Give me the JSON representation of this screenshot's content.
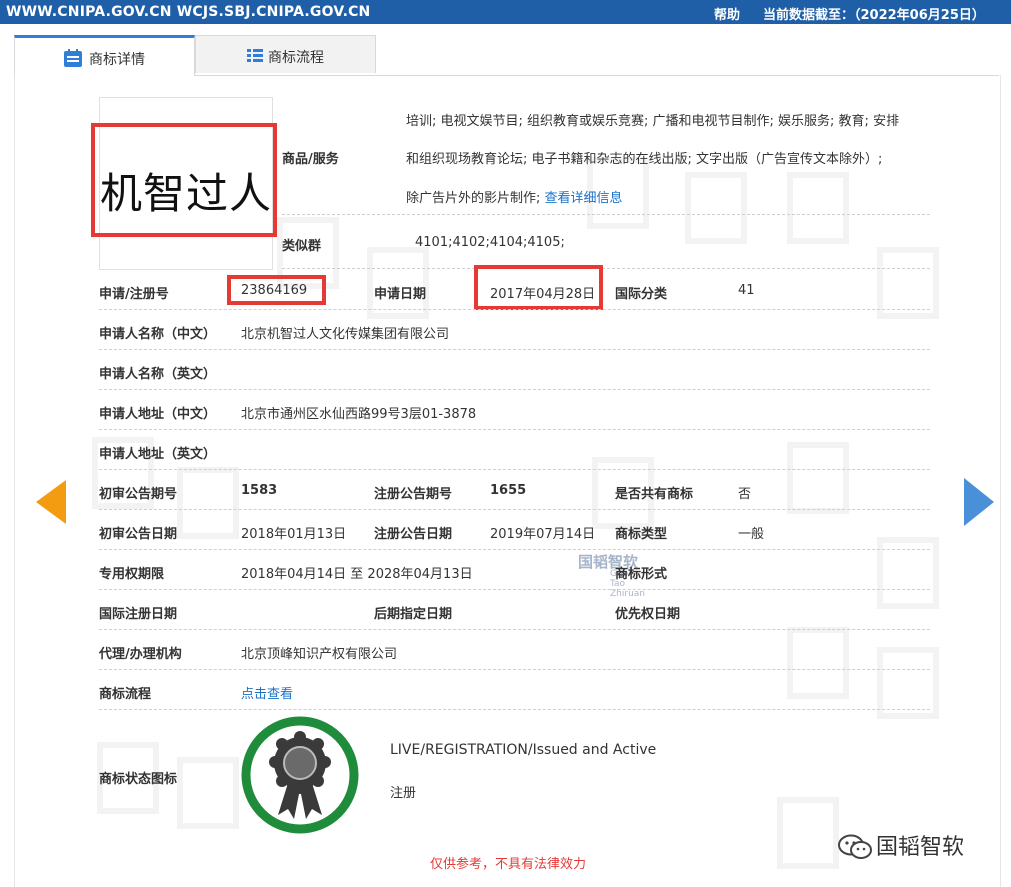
{
  "topbar": {
    "url": "WWW.CNIPA.GOV.CN WCJS.SBJ.CNIPA.GOV.CN",
    "help": "帮助",
    "cutoff": "当前数据截至：（2022年06月25日）"
  },
  "tabs": {
    "detail": "商标详情",
    "process": "商标流程"
  },
  "mark": {
    "name": "机智过人"
  },
  "goods": {
    "label": "商品/服务",
    "lines": [
      "培训; 电视文娱节目; 组织教育或娱乐竞赛; 广播和电视节目制作; 娱乐服务; 教育; 安排",
      "和组织现场教育论坛; 电子书籍和杂志的在线出版; 文字出版（广告宣传文本除外）;",
      "除广告片外的影片制作;"
    ],
    "more_link": "查看详细信息"
  },
  "similar_group": {
    "label": "类似群",
    "value": "4101;4102;4104;4105;"
  },
  "rows": {
    "reg_no_label": "申请/注册号",
    "reg_no": "23864169",
    "app_date_label": "申请日期",
    "app_date": "2017年04月28日",
    "intl_class_label": "国际分类",
    "intl_class": "41",
    "applicant_cn_label": "申请人名称（中文）",
    "applicant_cn": "北京机智过人文化传媒集团有限公司",
    "applicant_en_label": "申请人名称（英文）",
    "applicant_en": "",
    "address_cn_label": "申请人地址（中文）",
    "address_cn": "北京市通州区水仙西路99号3层01-3878",
    "address_en_label": "申请人地址（英文）",
    "address_en": "",
    "prelim_no_label": "初审公告期号",
    "prelim_no": "1583",
    "reg_ann_no_label": "注册公告期号",
    "reg_ann_no": "1655",
    "shared_label": "是否共有商标",
    "shared": "否",
    "prelim_date_label": "初审公告日期",
    "prelim_date": "2018年01月13日",
    "reg_ann_date_label": "注册公告日期",
    "reg_ann_date": "2019年07月14日",
    "mark_type_label": "商标类型",
    "mark_type": "一般",
    "exclusive_label": "专用权期限",
    "exclusive": "2018年04月14日 至 2028年04月13日",
    "mark_form_label": "商标形式",
    "mark_form": "",
    "intl_reg_date_label": "国际注册日期",
    "intl_reg_date": "",
    "later_designation_label": "后期指定日期",
    "later_designation": "",
    "priority_date_label": "优先权日期",
    "priority_date": "",
    "agent_label": "代理/办理机构",
    "agent": "北京顶峰知识产权有限公司",
    "process_label": "商标流程",
    "process_link": "点击查看",
    "status_icon_label": "商标状态图标"
  },
  "status": {
    "en": "LIVE/REGISTRATION/Issued and Active",
    "cn": "注册"
  },
  "disclaimer": "仅供参考，不具有法律效力",
  "watermark_logo": {
    "name": "国韬智软",
    "sub": "Guo Tao Zhiruan"
  },
  "wechat_account": "国韬智软",
  "colors": {
    "topbar": "#1e5fa8",
    "highlight": "#e53935",
    "link": "#1a73c8",
    "seal_ring": "#1e8c3a",
    "prev_arrow": "#f39c12",
    "next_arrow": "#4a90d9"
  }
}
